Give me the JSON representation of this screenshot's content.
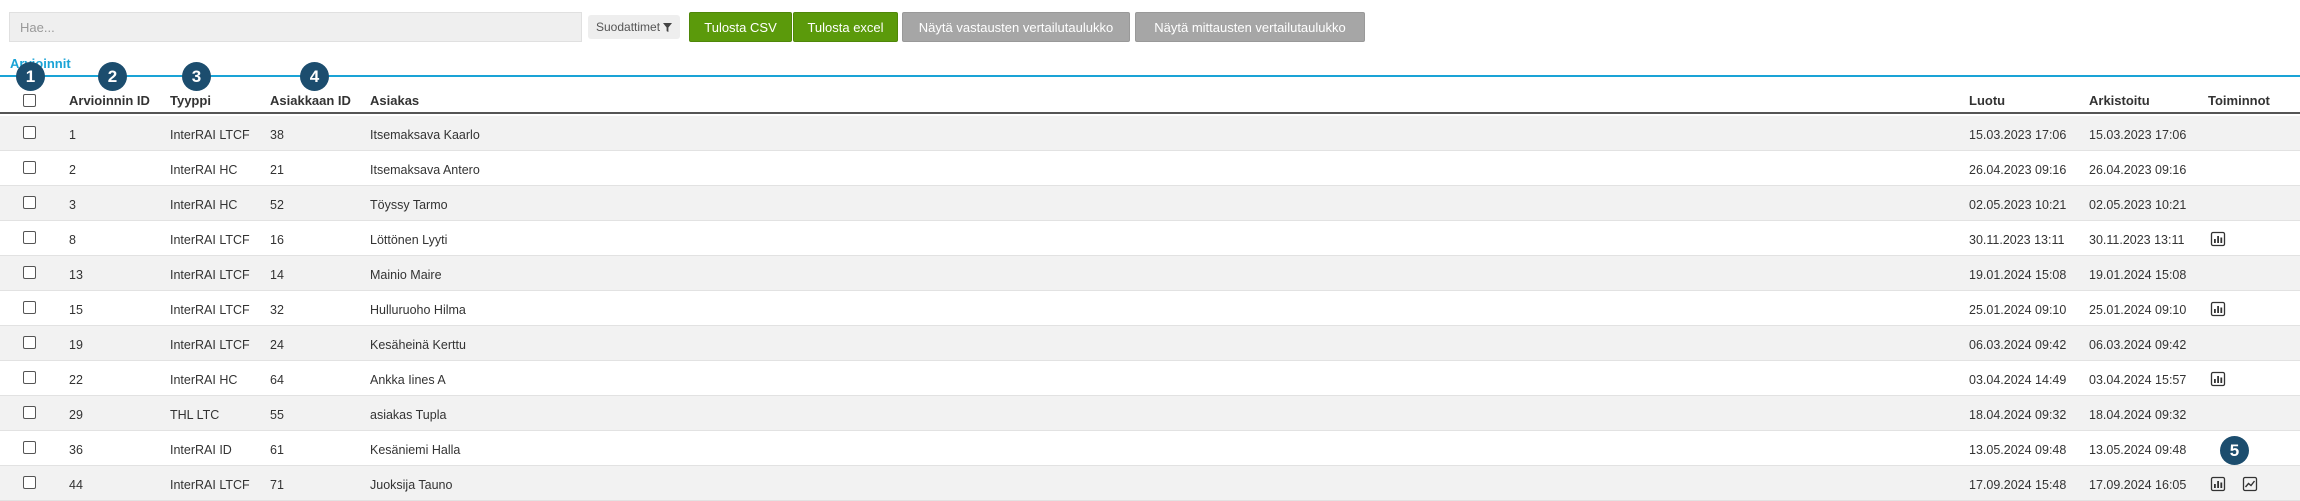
{
  "search": {
    "placeholder": "Hae..."
  },
  "toolbar": {
    "filters_label": "Suodattimet",
    "csv_label": "Tulosta CSV",
    "excel_label": "Tulosta excel",
    "answers_compare_label": "Näytä vastausten vertailutaulukko",
    "measures_compare_label": "Näytä mittausten vertailutaulukko"
  },
  "tab": {
    "label": "Arvioinnit"
  },
  "table": {
    "headers": {
      "assessment_id": "Arvioinnin ID",
      "type": "Tyyppi",
      "client_id": "Asiakkaan ID",
      "client": "Asiakas",
      "created": "Luotu",
      "archived": "Arkistoitu",
      "actions": "Toiminnot"
    },
    "rows": [
      {
        "id": "1",
        "type": "InterRAI LTCF",
        "client_id": "38",
        "client": "Itsemaksava Kaarlo",
        "created": "15.03.2023 17:06",
        "archived": "15.03.2023 17:06",
        "actions": []
      },
      {
        "id": "2",
        "type": "InterRAI HC",
        "client_id": "21",
        "client": "Itsemaksava Antero",
        "created": "26.04.2023 09:16",
        "archived": "26.04.2023 09:16",
        "actions": []
      },
      {
        "id": "3",
        "type": "InterRAI HC",
        "client_id": "52",
        "client": "Töyssy Tarmo",
        "created": "02.05.2023 10:21",
        "archived": "02.05.2023 10:21",
        "actions": []
      },
      {
        "id": "8",
        "type": "InterRAI LTCF",
        "client_id": "16",
        "client": "Löttönen Lyyti",
        "created": "30.11.2023 13:11",
        "archived": "30.11.2023 13:11",
        "actions": [
          "report-icon"
        ]
      },
      {
        "id": "13",
        "type": "InterRAI LTCF",
        "client_id": "14",
        "client": "Mainio Maire",
        "created": "19.01.2024 15:08",
        "archived": "19.01.2024 15:08",
        "actions": []
      },
      {
        "id": "15",
        "type": "InterRAI LTCF",
        "client_id": "32",
        "client": "Hulluruoho Hilma",
        "created": "25.01.2024 09:10",
        "archived": "25.01.2024 09:10",
        "actions": [
          "report-icon"
        ]
      },
      {
        "id": "19",
        "type": "InterRAI LTCF",
        "client_id": "24",
        "client": "Kesäheinä Kerttu",
        "created": "06.03.2024 09:42",
        "archived": "06.03.2024 09:42",
        "actions": []
      },
      {
        "id": "22",
        "type": "InterRAI HC",
        "client_id": "64",
        "client": "Ankka Iines A",
        "created": "03.04.2024 14:49",
        "archived": "03.04.2024 15:57",
        "actions": [
          "report-icon"
        ]
      },
      {
        "id": "29",
        "type": "THL LTC",
        "client_id": "55",
        "client": "asiakas Tupla",
        "created": "18.04.2024 09:32",
        "archived": "18.04.2024 09:32",
        "actions": []
      },
      {
        "id": "36",
        "type": "InterRAI ID",
        "client_id": "61",
        "client": "Kesäniemi Halla",
        "created": "13.05.2024 09:48",
        "archived": "13.05.2024 09:48",
        "actions": []
      },
      {
        "id": "44",
        "type": "InterRAI LTCF",
        "client_id": "71",
        "client": "Juoksija Tauno",
        "created": "17.09.2024 15:48",
        "archived": "17.09.2024 16:05",
        "actions": [
          "report-icon",
          "trend-chart-icon"
        ]
      }
    ]
  },
  "markers": [
    "1",
    "2",
    "3",
    "4",
    "5"
  ],
  "colors": {
    "accent": "#1aa3d6",
    "primary_button": "#5b9a0b",
    "secondary_button": "#a6a6a6",
    "marker": "#1c4d6e"
  }
}
